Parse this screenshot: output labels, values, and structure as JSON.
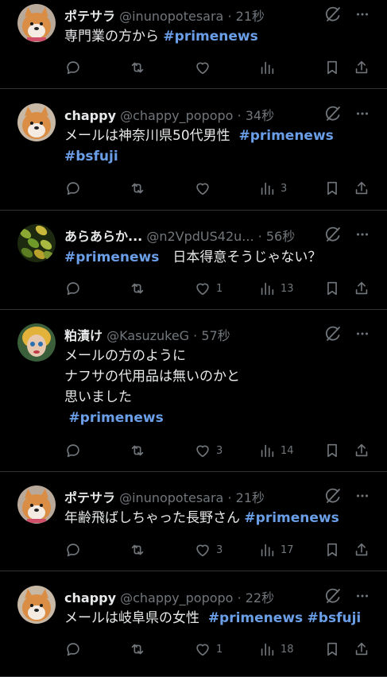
{
  "colors": {
    "background": "#000000",
    "hashtag": "#6a9fe8",
    "muted": "#71767b",
    "text": "#e7e9ea"
  },
  "posts": [
    {
      "name": "ポテサラ",
      "handle": "@inunopotesara",
      "dot": "·",
      "time": "21秒",
      "body": [
        {
          "t": "専門業の方から "
        },
        {
          "t": "#primenews",
          "tag": true
        }
      ],
      "replies": "",
      "reposts": "",
      "likes": "",
      "views": ""
    },
    {
      "name": "chappy",
      "handle": "@chappy_popopo",
      "dot": "·",
      "time": "34秒",
      "body": [
        {
          "t": "メールは神奈川県50代男性  "
        },
        {
          "t": "#primenews",
          "tag": true
        },
        {
          "t": "\n"
        },
        {
          "t": "#bsfuji",
          "tag": true
        }
      ],
      "replies": "",
      "reposts": "",
      "likes": "",
      "views": "3"
    },
    {
      "name": "あらあらか...",
      "handle": "@n2VpdUS42u...",
      "dot": "·",
      "time": "56秒",
      "body": [
        {
          "t": "#primenews",
          "tag": true
        },
        {
          "t": "　日本得意そうじゃない？"
        }
      ],
      "replies": "",
      "reposts": "",
      "likes": "1",
      "views": "13"
    },
    {
      "name": "粕漬け",
      "handle": "@KasuzukeG",
      "dot": "·",
      "time": "57秒",
      "body": [
        {
          "t": "メールの方のように\nナフサの代用品は無いのかと\n思いました\n "
        },
        {
          "t": "#primenews",
          "tag": true
        }
      ],
      "replies": "",
      "reposts": "",
      "likes": "3",
      "views": "14"
    },
    {
      "name": "ポテサラ",
      "handle": "@inunopotesara",
      "dot": "·",
      "time": "21秒",
      "body": [
        {
          "t": "年齢飛ばしちゃった長野さん "
        },
        {
          "t": "#primenews",
          "tag": true
        }
      ],
      "replies": "",
      "reposts": "",
      "likes": "3",
      "views": "17"
    },
    {
      "name": "chappy",
      "handle": "@chappy_popopo",
      "dot": "·",
      "time": "22秒",
      "body": [
        {
          "t": "メールは岐阜県の女性  "
        },
        {
          "t": "#primenews",
          "tag": true
        },
        {
          "t": " "
        },
        {
          "t": "#bsfuji",
          "tag": true
        }
      ],
      "replies": "",
      "reposts": "",
      "likes": "1",
      "views": "18"
    }
  ]
}
